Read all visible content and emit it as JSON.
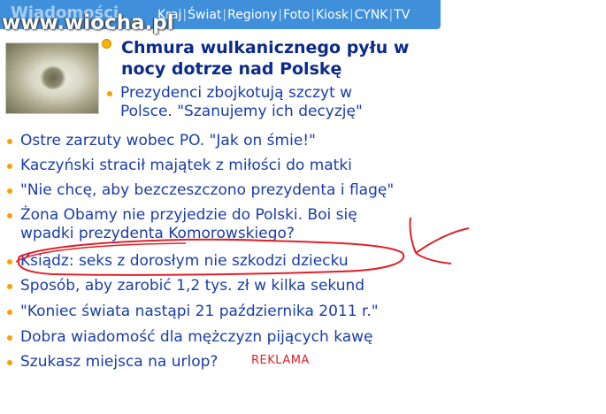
{
  "header": {
    "section_title": "Wiadomości",
    "nav": [
      "Kraj",
      "Świat",
      "Regiony",
      "Foto",
      "Kiosk",
      "CYNK",
      "TV"
    ]
  },
  "watermark": "www.wiocha.pl",
  "featured": {
    "headline": "Chmura wulkanicznego pyłu w nocy dotrze nad Polskę",
    "sub": "Prezydenci zbojkotują szczyt w Polsce. \"Szanujemy ich decyzję\""
  },
  "news": [
    "Ostre zarzuty wobec PO. \"Jak on śmie!\"",
    "Kaczyński stracił majątek z miłości do matki",
    "\"Nie chcę, aby bezczeszczono prezydenta i flagę\"",
    "Żona Obamy nie przyjedzie do Polski. Boi się wpadki prezydenta Komorowskiego?",
    "Ksiądz: seks z dorosłym nie szkodzi dziecku",
    "Sposób, aby zarobić 1,2 tys. zł w kilka sekund",
    "\"Koniec świata nastąpi 21 października 2011 r.\"",
    "Dobra wiadomość dla mężczyzn pijących kawę",
    "Szukasz miejsca na urlop?"
  ],
  "ad_label": "REKLAMA",
  "colors": {
    "topbar": "#3f8fda",
    "link": "#1a3ca8",
    "headline": "#0b2a8a",
    "bullet": "#f5a300",
    "annotation": "#e0202a"
  }
}
